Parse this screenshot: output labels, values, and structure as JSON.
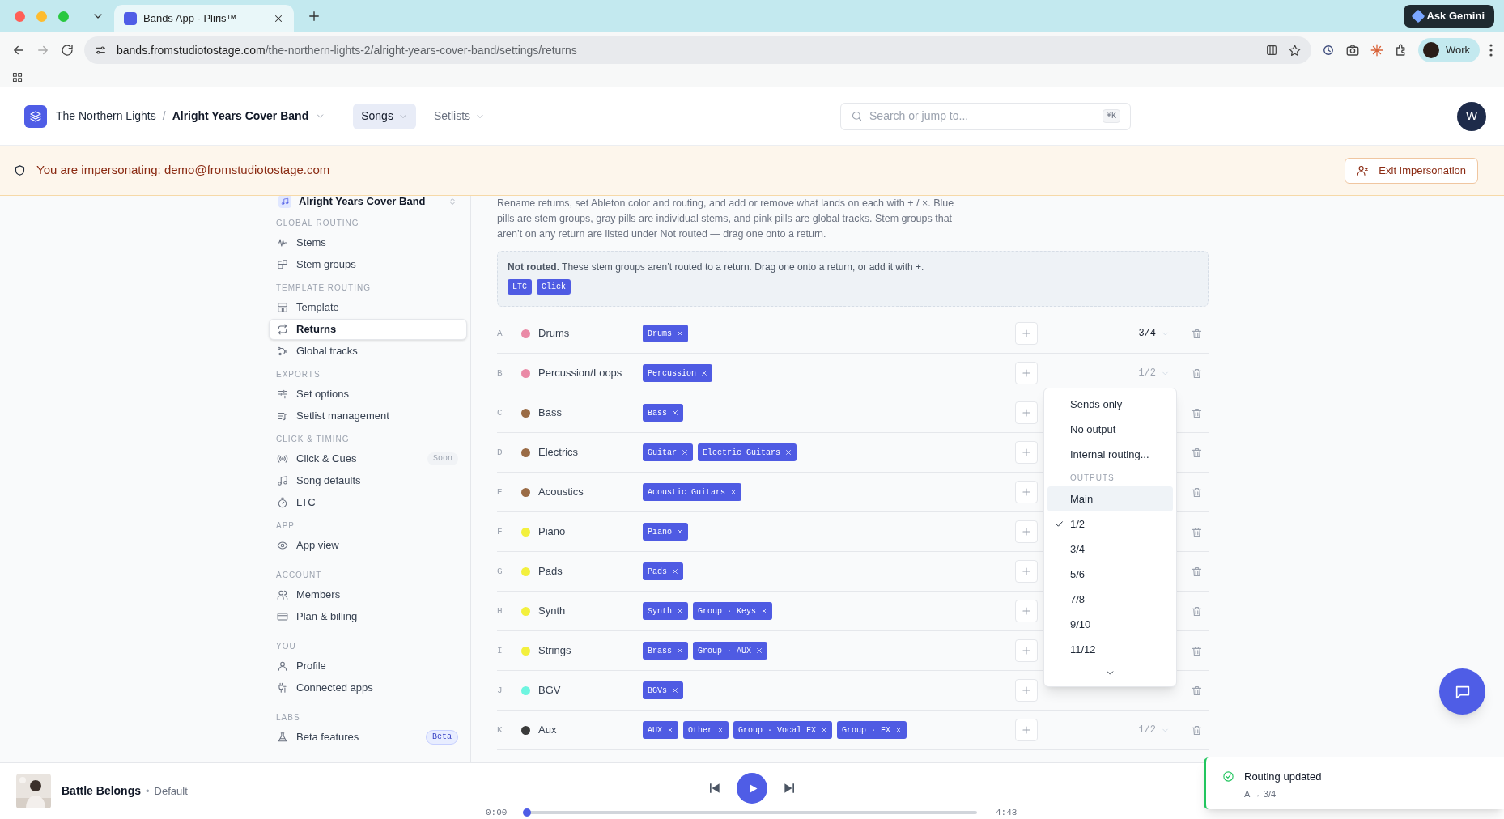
{
  "browser": {
    "tab_title": "Bands App - Pliris™",
    "gemini": "Ask Gemini",
    "url_host": "bands.fromstudiotostage.com",
    "url_path": "/the-northern-lights-2/alright-years-cover-band/settings/returns",
    "profile": "Work"
  },
  "header": {
    "workspace": "The Northern Lights",
    "separator": "/",
    "band": "Alright Years Cover Band",
    "nav": [
      {
        "label": "Songs",
        "selected": true
      },
      {
        "label": "Setlists",
        "selected": false
      }
    ],
    "search": {
      "placeholder": "Search or jump to...",
      "shortcut": "⌘K"
    },
    "avatar": "W"
  },
  "banner": {
    "message": "You are impersonating: demo@fromstudiotostage.com",
    "button": "Exit Impersonation"
  },
  "sidebar": {
    "band": "Alright Years Cover Band",
    "sections": [
      {
        "title": "GLOBAL ROUTING",
        "items": [
          {
            "label": "Stems",
            "selected": false
          },
          {
            "label": "Stem groups",
            "selected": false
          }
        ]
      },
      {
        "title": "TEMPLATE ROUTING",
        "items": [
          {
            "label": "Template",
            "selected": false
          },
          {
            "label": "Returns",
            "selected": true
          },
          {
            "label": "Global tracks",
            "selected": false
          }
        ]
      },
      {
        "title": "EXPORTS",
        "items": [
          {
            "label": "Set options",
            "selected": false
          },
          {
            "label": "Setlist management",
            "selected": false
          }
        ]
      },
      {
        "title": "CLICK & TIMING",
        "items": [
          {
            "label": "Click & Cues",
            "selected": false,
            "badge": {
              "text": "Soon",
              "kind": "muted"
            }
          },
          {
            "label": "Song defaults",
            "selected": false
          },
          {
            "label": "LTC",
            "selected": false
          }
        ]
      },
      {
        "title": "APP",
        "items": [
          {
            "label": "App view",
            "selected": false
          }
        ]
      },
      {
        "title": "ACCOUNT",
        "items": [
          {
            "label": "Members",
            "selected": false
          },
          {
            "label": "Plan & billing",
            "selected": false
          }
        ]
      },
      {
        "title": "YOU",
        "items": [
          {
            "label": "Profile",
            "selected": false
          },
          {
            "label": "Connected apps",
            "selected": false
          }
        ]
      },
      {
        "title": "LABS",
        "items": [
          {
            "label": "Beta features",
            "selected": false,
            "badge": {
              "text": "Beta",
              "kind": "accent"
            }
          }
        ]
      }
    ]
  },
  "description": "Rename returns, set Ableton color and routing, and add or remove what lands on each with + / ×. Blue pills are stem groups, gray pills are individual stems, and pink pills are global tracks. Stem groups that aren’t on any return are listed under Not routed — drag one onto a return.",
  "not_routed": {
    "text": "**Not routed.** These stem groups aren’t routed to a return. Drag one onto a return, or add it with +.",
    "pills": [
      "LTC",
      "Click"
    ]
  },
  "returns": [
    {
      "letter": "A",
      "color": "#ea89a6",
      "name": "Drums",
      "pills": [
        "Drums"
      ],
      "output": {
        "label": "3/4",
        "emphasized": true
      }
    },
    {
      "letter": "B",
      "color": "#ea89a6",
      "name": "Percussion/Loops",
      "pills": [
        "Percussion"
      ],
      "output": {
        "label": "1/2",
        "emphasized": false
      }
    },
    {
      "letter": "C",
      "color": "#9a6b45",
      "name": "Bass",
      "pills": [
        "Bass"
      ]
    },
    {
      "letter": "D",
      "color": "#9a6b45",
      "name": "Electrics",
      "pills": [
        "Guitar",
        "Electric Guitars"
      ]
    },
    {
      "letter": "E",
      "color": "#9a6b45",
      "name": "Acoustics",
      "pills": [
        "Acoustic Guitars"
      ]
    },
    {
      "letter": "F",
      "color": "#f3f03d",
      "name": "Piano",
      "pills": [
        "Piano"
      ]
    },
    {
      "letter": "G",
      "color": "#f3f03d",
      "name": "Pads",
      "pills": [
        "Pads"
      ]
    },
    {
      "letter": "H",
      "color": "#f3f03d",
      "name": "Synth",
      "pills": [
        "Synth",
        "Group · Keys"
      ]
    },
    {
      "letter": "I",
      "color": "#f3f03d",
      "name": "Strings",
      "pills": [
        "Brass",
        "Group · AUX"
      ]
    },
    {
      "letter": "J",
      "color": "#6ef5e0",
      "name": "BGV",
      "pills": [
        "BGVs"
      ]
    },
    {
      "letter": "K",
      "color": "#3a3a3a",
      "name": "Aux",
      "pills": [
        "AUX",
        "Other",
        "Group · Vocal FX",
        "Group · FX"
      ],
      "output": {
        "label": "1/2",
        "emphasized": false
      }
    }
  ],
  "output_menu": {
    "items": [
      {
        "kind": "option",
        "label": "Sends only",
        "checked": false,
        "highlighted": false
      },
      {
        "kind": "option",
        "label": "No output",
        "checked": false,
        "highlighted": false
      },
      {
        "kind": "option",
        "label": "Internal routing...",
        "checked": false,
        "highlighted": false
      },
      {
        "kind": "heading",
        "label": "OUTPUTS"
      },
      {
        "kind": "option",
        "label": "Main",
        "checked": false,
        "highlighted": true
      },
      {
        "kind": "option",
        "label": "1/2",
        "checked": true,
        "highlighted": false
      },
      {
        "kind": "option",
        "label": "3/4",
        "checked": false,
        "highlighted": false
      },
      {
        "kind": "option",
        "label": "5/6",
        "checked": false,
        "highlighted": false
      },
      {
        "kind": "option",
        "label": "7/8",
        "checked": false,
        "highlighted": false
      },
      {
        "kind": "option",
        "label": "9/10",
        "checked": false,
        "highlighted": false
      },
      {
        "kind": "option",
        "label": "11/12",
        "checked": false,
        "highlighted": false
      }
    ]
  },
  "player": {
    "track": "Battle Belongs",
    "separator": "•",
    "variant": "Default",
    "elapsed": "0:00",
    "duration": "4:43",
    "level": 0
  },
  "toast": {
    "title": "Routing updated",
    "detail": "A → 3/4"
  }
}
